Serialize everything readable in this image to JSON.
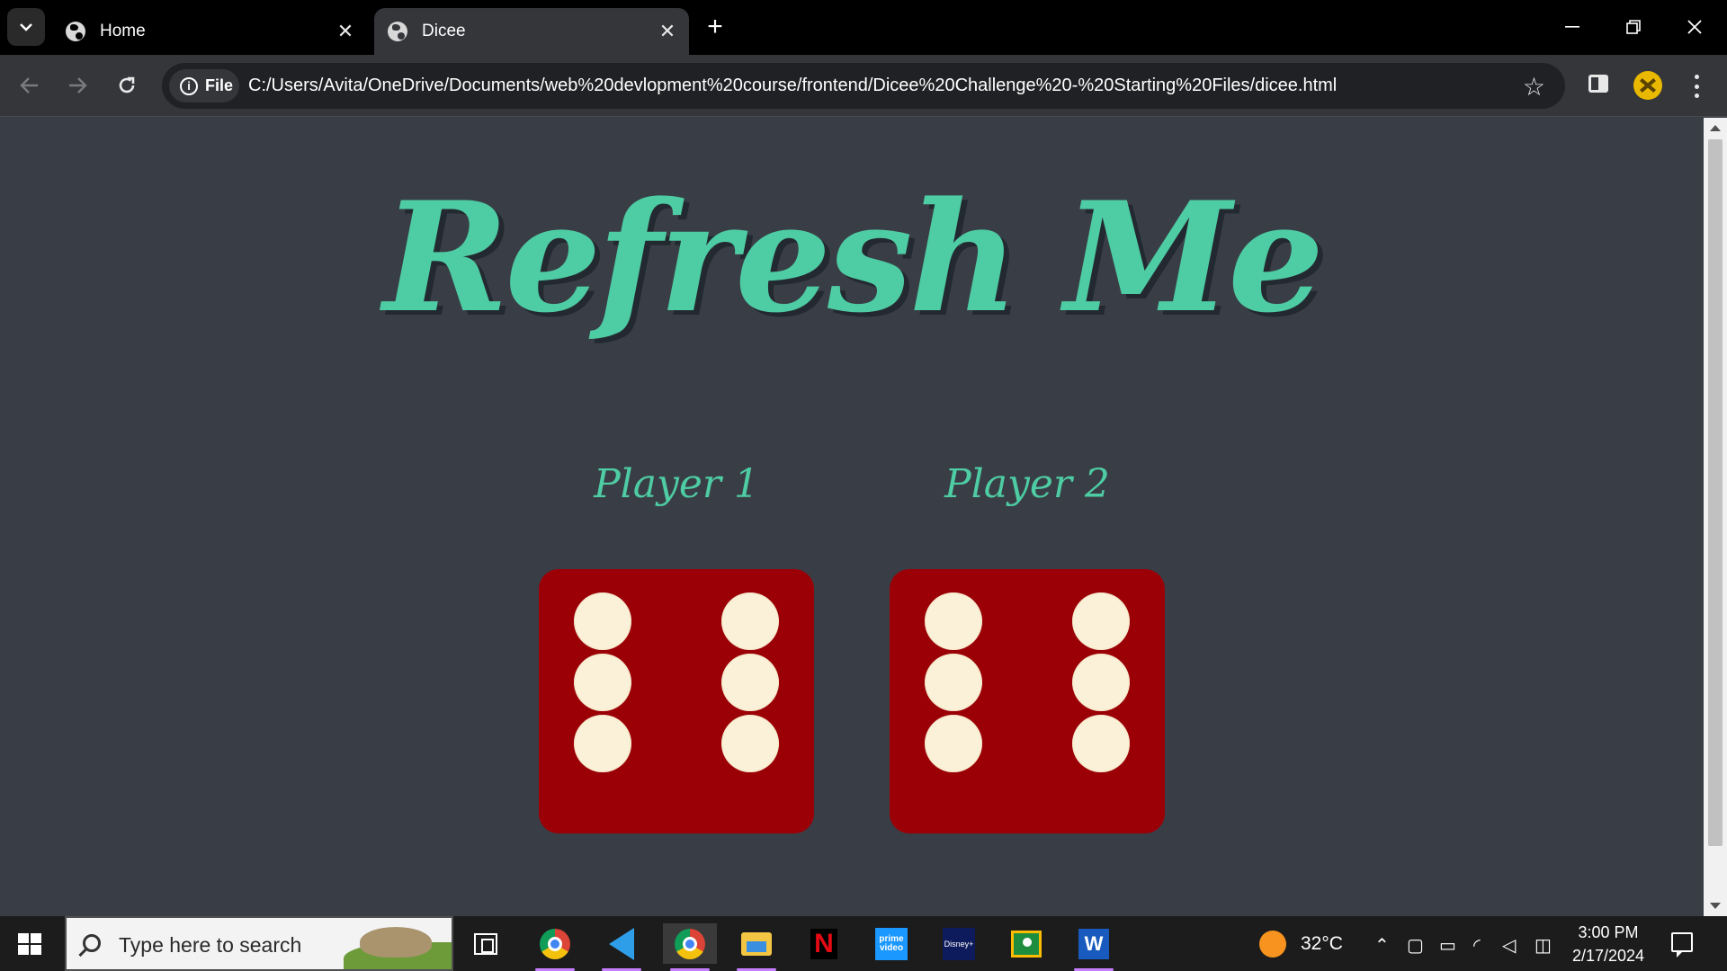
{
  "browser": {
    "tabs": [
      {
        "title": "Home",
        "active": false
      },
      {
        "title": "Dicee",
        "active": true
      }
    ],
    "omnibox": {
      "scheme_chip": "File",
      "url": "C:/Users/Avita/OneDrive/Documents/web%20devlopment%20course/frontend/Dicee%20Challenge%20-%20Starting%20Files/dicee.html"
    },
    "icons": [
      "tab-search-icon",
      "globe-icon",
      "close-icon",
      "new-tab-icon",
      "minimize-icon",
      "restore-icon",
      "window-close-icon",
      "back-icon",
      "forward-icon",
      "reload-icon",
      "info-icon",
      "bookmark-star-icon",
      "side-panel-icon",
      "profile-avatar",
      "more-menu-icon"
    ]
  },
  "page": {
    "headline": "Refresh Me",
    "players": [
      {
        "label": "Player 1",
        "die_value": 6
      },
      {
        "label": "Player 2",
        "die_value": 6
      }
    ],
    "colors": {
      "background": "#393e46",
      "accent": "#4ecca3",
      "die": "#9b0007",
      "pip": "#fbf1d8"
    }
  },
  "taskbar": {
    "search_placeholder": "Type here to search",
    "apps": [
      "task-view",
      "chrome-profile-1",
      "vscode",
      "chrome-profile-2",
      "file-explorer",
      "netflix",
      "prime-video",
      "disney-plus",
      "google-classroom",
      "word"
    ],
    "weather": {
      "temp": "32°C"
    },
    "clock": {
      "time": "3:00 PM",
      "date": "2/17/2024"
    },
    "netflix_glyph": "N",
    "prime_text": "prime video",
    "disney_text": "Disney+",
    "word_glyph": "W"
  }
}
